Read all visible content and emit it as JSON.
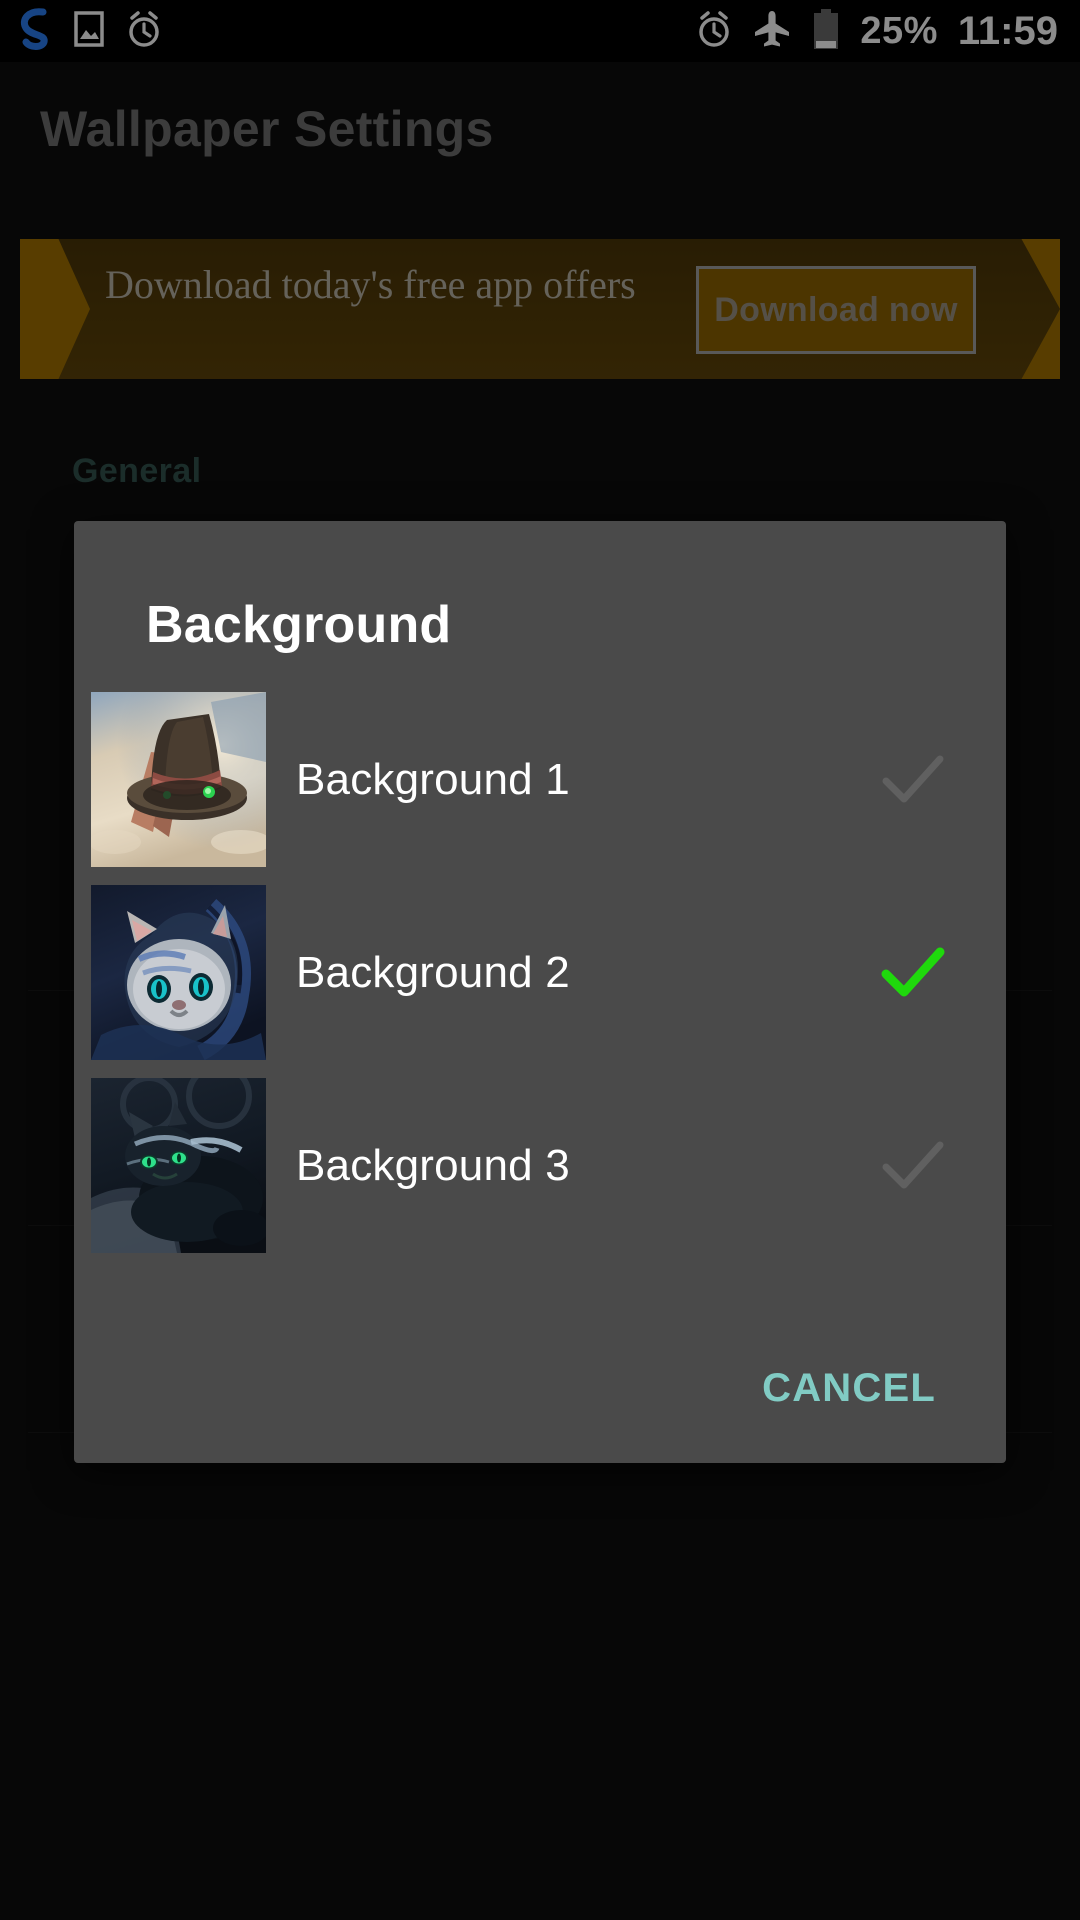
{
  "statusbar": {
    "left_icons": [
      {
        "name": "app-logo-icon",
        "glyph": "S"
      },
      {
        "name": "image-icon",
        "glyph": "image"
      },
      {
        "name": "alarm-icon",
        "glyph": "alarm"
      }
    ],
    "right_icons": [
      {
        "name": "alarm-icon",
        "glyph": "alarm"
      },
      {
        "name": "airplane-mode-icon",
        "glyph": "airplane"
      },
      {
        "name": "battery-icon",
        "glyph": "battery"
      }
    ],
    "battery_percent": "25%",
    "clock": "11:59"
  },
  "header": {
    "title": "Wallpaper Settings"
  },
  "ad_banner": {
    "text": "Download today's free app offers",
    "cta_label": "Download now"
  },
  "settings": {
    "section_label": "General"
  },
  "dialog": {
    "title": "Background",
    "options": [
      {
        "label": "Background 1",
        "selected": false,
        "thumb": "top-hat-thumbnail"
      },
      {
        "label": "Background 2",
        "selected": true,
        "thumb": "blue-cheshire-cat-thumbnail"
      },
      {
        "label": "Background 3",
        "selected": false,
        "thumb": "dark-cat-thumbnail"
      }
    ],
    "cancel_label": "CANCEL"
  },
  "colors": {
    "accent_teal": "#81cbc4",
    "selected_check_green": "#1fd90c",
    "unselected_check_gray": "#5c5c5c",
    "dialog_bg": "#4a4a4a",
    "page_bg": "#0d0d0d",
    "banner_gold": "#a07000"
  }
}
